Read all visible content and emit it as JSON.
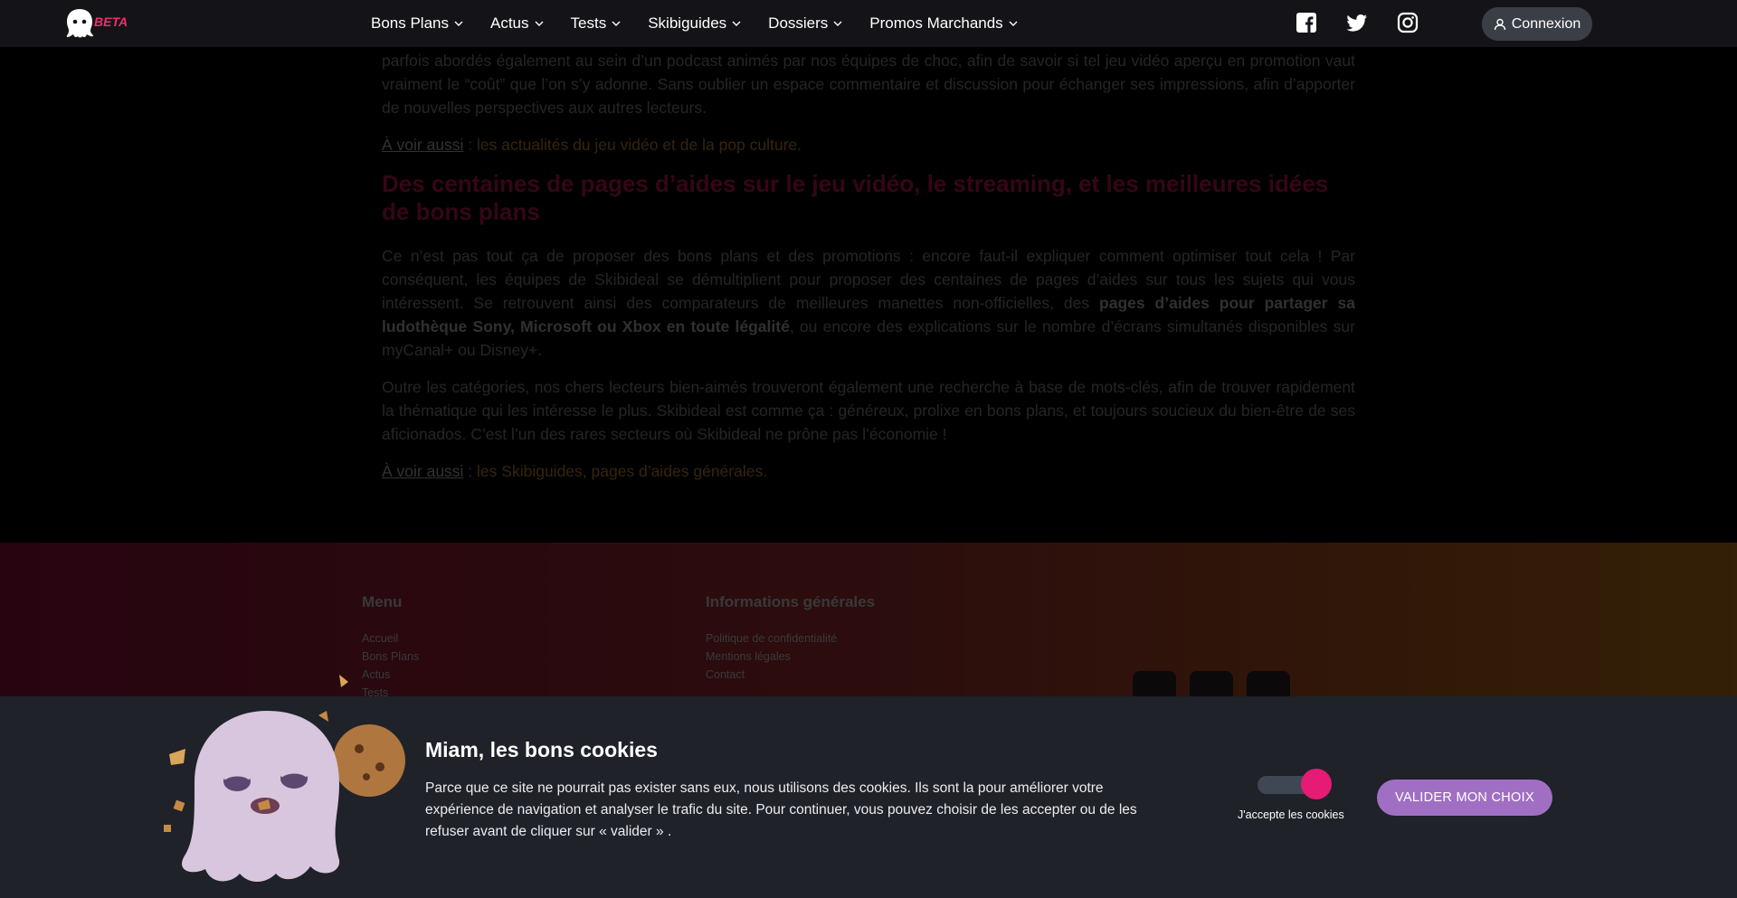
{
  "header": {
    "beta": "BETA",
    "nav": [
      {
        "label": "Bons Plans"
      },
      {
        "label": "Actus"
      },
      {
        "label": "Tests"
      },
      {
        "label": "Skibiguides"
      },
      {
        "label": "Dossiers"
      },
      {
        "label": "Promos Marchands"
      }
    ],
    "login_label": "Connexion"
  },
  "article": {
    "p0a": "parfois abordés également au sein d’un podcast animés par nos équipes de choc, afin de savoir si tel jeu vidéo aperçu en promotion vaut vraiment le “coût” que l’on s’y adonne. Sans oublier un espace commentaire et discussion pour échanger ses impressions, afin d’apporter de nouvelles perspectives aux autres lecteurs.",
    "see1_label": "À voir aussi",
    "see1_sep": " : ",
    "see1_link": "les actualités du jeu vidéo et de la pop culture.",
    "heading": "Des centaines de pages d’aides sur le jeu vidéo, le streaming, et les meilleures idées de bons plans",
    "p1a": "Ce n’est pas tout ça de proposer des bons plans et des promotions : encore faut-il expliquer comment optimiser tout cela ! Par conséquent, les équipes de Skibideal se démultiplient pour proposer des centaines de pages d’aides sur tous les sujets qui vous intéressent. Se retrouvent ainsi des comparateurs de meilleures manettes non-officielles, des ",
    "p1b": "pages d’aides pour partager sa ludothèque Sony, Microsoft ou Xbox en toute légalité",
    "p1c": ", ou encore des explications sur le nombre d’écrans simultanés disponibles sur myCanal+ ou Disney+.",
    "p2": "Outre les catégories, nos chers lecteurs bien-aimés trouveront également une recherche à base de mots-clés, afin de trouver rapidement la thématique qui les intéresse le plus. Skibideal est comme ça : généreux, prolixe en bons plans, et toujours soucieux du bien-être de ses aficionados. C’est l’un des rares secteurs où Skibideal ne prône pas l’économie !",
    "see2_label": "À voir aussi",
    "see2_sep": " : ",
    "see2_link": "les Skibiguides, pages d’aides générales."
  },
  "footer": {
    "menu_title": "Menu",
    "menu_items": [
      "Accueil",
      "Bons Plans",
      "Actus",
      "Tests"
    ],
    "info_title": "Informations générales",
    "info_items": [
      "Politique de confidentialité",
      "Mentions légales",
      "Contact"
    ]
  },
  "cookie": {
    "title": "Miam, les bons cookies",
    "text": "Parce que ce site ne pourrait pas exister sans eux, nous utilisons des cookies. Ils sont la pour améliorer votre expérience de navigation et analyser le trafic du site. Pour continuer, vous pouvez choisir de les accepter ou de les refuser avant de cliquer sur « valider » .",
    "toggle_label": "J'accepte les cookies",
    "toggle_on": true,
    "validate_label": "VALIDER MON CHOIX"
  },
  "colors": {
    "accent": "#e61b75",
    "button": "#a06fc3",
    "heading": "#ea1f63"
  }
}
